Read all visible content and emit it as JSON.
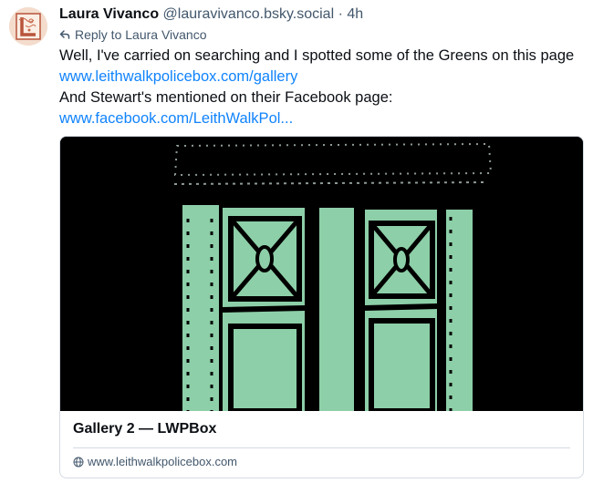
{
  "post": {
    "author_name": "Laura Vivanco",
    "handle": "@lauravivanco.bsky.social",
    "separator": "·",
    "time": "4h",
    "reply_to": "Reply to Laura Vivanco",
    "text_line1": "Well, I've carried on searching and I spotted some of the Greens on this page ",
    "link1": "www.leithwalkpolicebox.com/gallery",
    "text_line2": "And Stewart's mentioned on their Facebook page:",
    "link2": "www.facebook.com/LeithWalkPol..."
  },
  "embed": {
    "title": "Gallery 2 — LWPBox",
    "domain": "www.leithwalkpolicebox.com"
  },
  "colors": {
    "link": "#1083fe",
    "muted": "#42576c",
    "border": "#d4dbe2",
    "door_green": "#8dcfa8"
  }
}
